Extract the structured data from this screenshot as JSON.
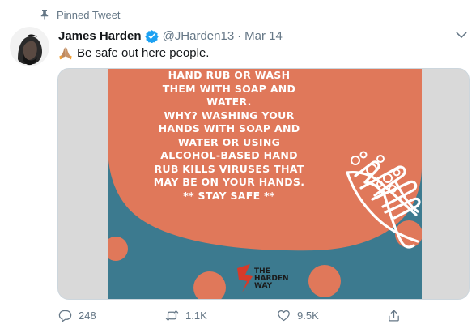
{
  "pinned": {
    "label": "Pinned Tweet",
    "icon": "pin-icon"
  },
  "author": {
    "name": "James Harden",
    "handle": "@JHarden13",
    "separator": "·",
    "date": "Mar 14",
    "verified": true
  },
  "tweet": {
    "emoji": "🙏🏽",
    "text": "Be safe out here people."
  },
  "media": {
    "poster_lines": [
      "HAND RUB OR WASH",
      "THEM WITH SOAP AND",
      "WATER.",
      "WHY? WASHING YOUR",
      "HANDS WITH SOAP AND",
      "WATER OR USING",
      "ALCOHOL-BASED HAND",
      "RUB KILLS VIRUSES THAT",
      "MAY BE ON YOUR HANDS.",
      "** STAY SAFE **"
    ],
    "logo": {
      "numeral": "3",
      "line1": "THE",
      "line2": "HARDEN",
      "line3": "WAY"
    },
    "colors": {
      "orange": "#e0785a",
      "teal": "#3c7a8f",
      "frame": "#d9d9d9"
    }
  },
  "actions": {
    "replies": "248",
    "retweets": "1.1K",
    "likes": "9.5K"
  },
  "colors": {
    "text": "#14171a",
    "secondary": "#657786",
    "verified": "#1da1f2"
  }
}
